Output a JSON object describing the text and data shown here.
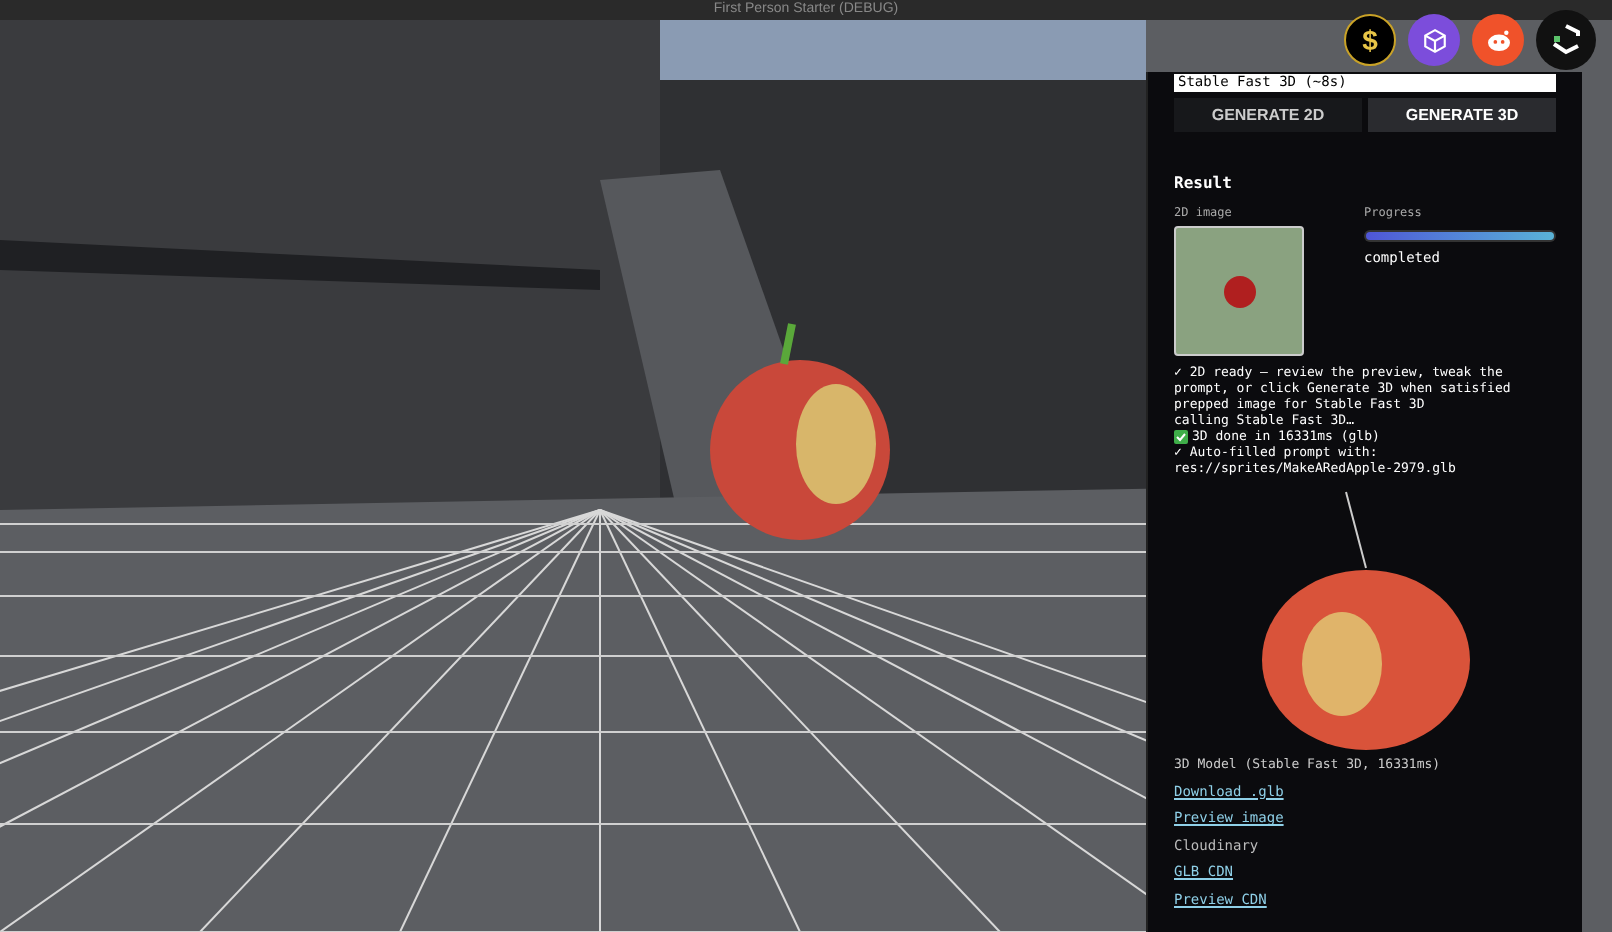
{
  "window": {
    "title": "First Person Starter (DEBUG)"
  },
  "toolbar": [
    {
      "kind": "coin",
      "label": "$"
    },
    {
      "kind": "cube"
    },
    {
      "kind": "reddit"
    },
    {
      "kind": "logo"
    }
  ],
  "panel": {
    "model_field": {
      "value": "Stable Fast 3D (~8s)"
    },
    "buttons": [
      {
        "label": "GENERATE 2D",
        "selected": false
      },
      {
        "label": "GENERATE 3D",
        "selected": true
      }
    ],
    "result": {
      "title": "Result",
      "image_label": "2D image",
      "progress_label": "Progress",
      "progress": {
        "level": 1.0,
        "status": "completed"
      }
    },
    "log": [
      {
        "kind": "plain",
        "text": "✓ 2D ready — review the preview, tweak the prompt, or click Generate 3D when satisfied"
      },
      {
        "kind": "plain",
        "text": "prepped image for Stable Fast 3D"
      },
      {
        "kind": "plain",
        "text": "calling Stable Fast 3D…"
      },
      {
        "kind": "done",
        "text": "3D done in 16331ms (glb)"
      },
      {
        "kind": "plain",
        "text": "✓ Auto-filled prompt with: res://sprites/MakeARedApple-2979.glb"
      }
    ],
    "model_caption": "3D Model (Stable Fast 3D, 16331ms)",
    "links": [
      {
        "kind": "link",
        "text": "Download .glb"
      },
      {
        "kind": "link",
        "text": "Preview image"
      },
      {
        "kind": "label",
        "text": "Cloudinary"
      },
      {
        "kind": "link",
        "text": "GLB CDN"
      },
      {
        "kind": "link",
        "text": "Preview CDN"
      }
    ]
  }
}
